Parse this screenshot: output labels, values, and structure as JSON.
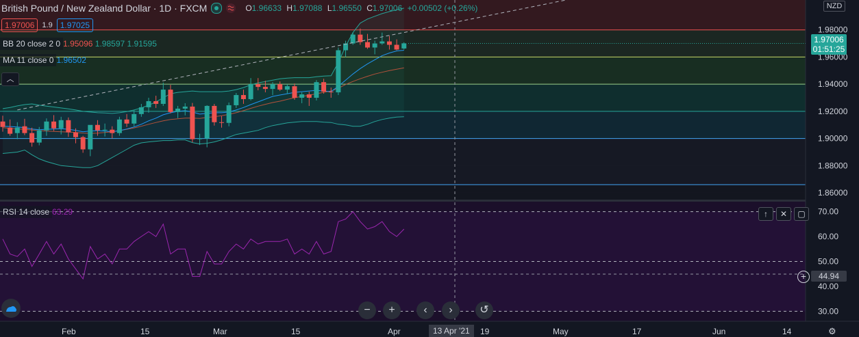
{
  "header": {
    "symbol_title": "British Pound / New Zealand Dollar · 1D · FXCM",
    "ohlc": {
      "o_label": "O",
      "o": "1.96633",
      "h_label": "H",
      "h": "1.97088",
      "l_label": "L",
      "l": "1.96550",
      "c_label": "C",
      "c": "1.97006",
      "change": "+0.00502 (+0.26%)"
    },
    "bid": "1.97006",
    "spread": "1.9",
    "ask": "1.97025"
  },
  "indicators": {
    "bb": {
      "label": "BB 20 close 2 0",
      "lower": "1.95096",
      "basis": "1.98597",
      "upper": "1.91595"
    },
    "ma": {
      "label": "MA 11 close 0",
      "value": "1.96502"
    },
    "rsi": {
      "label": "RSI 14 close",
      "value": "63.29"
    }
  },
  "price_axis": {
    "currency": "NZD",
    "ticks": [
      "1.98000",
      "1.96000",
      "1.94000",
      "1.92000",
      "1.90000",
      "1.88000",
      "1.86000"
    ],
    "last_price": "1.97006",
    "countdown": "01:51:25"
  },
  "rsi_axis": {
    "ticks": [
      "70.00",
      "60.00",
      "50.00",
      "40.00",
      "30.00"
    ],
    "cursor_value": "44.94"
  },
  "time_axis": {
    "labels": [
      "Feb",
      "15",
      "Mar",
      "15",
      "Apr",
      "19",
      "May",
      "17",
      "Jun",
      "14"
    ],
    "cursor_label": "13 Apr '21"
  },
  "colors": {
    "up": "#26a69a",
    "down": "#ef5350",
    "bb": "#26a69a",
    "ma": "#2196f3",
    "rsi": "#9c27b0",
    "background": "#131722"
  },
  "chart_data": {
    "type": "candlestick",
    "ylim": [
      1.855,
      2.002
    ],
    "candles": [
      [
        1.9125,
        1.9168,
        1.905,
        1.9085
      ],
      [
        1.908,
        1.914,
        1.902,
        1.9035
      ],
      [
        1.904,
        1.912,
        1.8995,
        1.908
      ],
      [
        1.909,
        1.9145,
        1.9025,
        1.904
      ],
      [
        1.904,
        1.908,
        1.894,
        1.897
      ],
      [
        1.897,
        1.9085,
        1.895,
        1.906
      ],
      [
        1.906,
        1.9148,
        1.902,
        1.9125
      ],
      [
        1.9125,
        1.9172,
        1.9055,
        1.9075
      ],
      [
        1.9075,
        1.916,
        1.903,
        1.9135
      ],
      [
        1.9135,
        1.9155,
        1.9012,
        1.9045
      ],
      [
        1.9045,
        1.9075,
        1.8965,
        1.901
      ],
      [
        1.901,
        1.902,
        1.8895,
        1.892
      ],
      [
        1.892,
        1.907,
        1.887,
        1.91
      ],
      [
        1.91,
        1.9135,
        1.902,
        1.906
      ],
      [
        1.906,
        1.911,
        1.9015,
        1.9065
      ],
      [
        1.9065,
        1.909,
        1.9,
        1.904
      ],
      [
        1.904,
        1.916,
        1.902,
        1.914
      ],
      [
        1.914,
        1.918,
        1.9085,
        1.911
      ],
      [
        1.911,
        1.921,
        1.909,
        1.918
      ],
      [
        1.918,
        1.9255,
        1.916,
        1.923
      ],
      [
        1.923,
        1.93,
        1.919,
        1.9275
      ],
      [
        1.9275,
        1.9315,
        1.9225,
        1.9255
      ],
      [
        1.9255,
        1.9412,
        1.924,
        1.936
      ],
      [
        1.936,
        1.9395,
        1.9185,
        1.9195
      ],
      [
        1.9195,
        1.924,
        1.915,
        1.922
      ],
      [
        1.922,
        1.926,
        1.917,
        1.9235
      ],
      [
        1.9235,
        1.9262,
        1.8972,
        1.8995
      ],
      [
        1.8995,
        1.9035,
        1.8952,
        1.9
      ],
      [
        1.9,
        1.9245,
        1.8935,
        1.924
      ],
      [
        1.924,
        1.9255,
        1.9095,
        1.912
      ],
      [
        1.912,
        1.9165,
        1.908,
        1.9115
      ],
      [
        1.9115,
        1.9265,
        1.909,
        1.9245
      ],
      [
        1.9245,
        1.9335,
        1.9225,
        1.932
      ],
      [
        1.932,
        1.936,
        1.9255,
        1.929
      ],
      [
        1.929,
        1.9445,
        1.928,
        1.94
      ],
      [
        1.94,
        1.9445,
        1.9355,
        1.938
      ],
      [
        1.938,
        1.9425,
        1.934,
        1.9365
      ],
      [
        1.9365,
        1.9415,
        1.932,
        1.94
      ],
      [
        1.94,
        1.942,
        1.935,
        1.936
      ],
      [
        1.936,
        1.94,
        1.933,
        1.9385
      ],
      [
        1.9385,
        1.9405,
        1.9285,
        1.93
      ],
      [
        1.93,
        1.934,
        1.926,
        1.9325
      ],
      [
        1.9325,
        1.9345,
        1.924,
        1.93
      ],
      [
        1.93,
        1.943,
        1.928,
        1.9415
      ],
      [
        1.9415,
        1.944,
        1.933,
        1.9345
      ],
      [
        1.9345,
        1.9375,
        1.93,
        1.934
      ],
      [
        1.934,
        1.967,
        1.932,
        1.965
      ],
      [
        1.965,
        1.972,
        1.96,
        1.97
      ],
      [
        1.97,
        1.978,
        1.969,
        1.9765
      ],
      [
        1.9765,
        1.981,
        1.969,
        1.971
      ],
      [
        1.971,
        1.977,
        1.966,
        1.967
      ],
      [
        1.967,
        1.972,
        1.962,
        1.97
      ],
      [
        1.97,
        1.978,
        1.969,
        1.9715
      ],
      [
        1.9715,
        1.9755,
        1.9655,
        1.969
      ],
      [
        1.969,
        1.973,
        1.965,
        1.9655
      ],
      [
        1.9663,
        1.9709,
        1.9655,
        1.9701
      ]
    ],
    "bb_upper": [
      1.922,
      1.9228,
      1.924,
      1.925,
      1.9255,
      1.9245,
      1.9238,
      1.9232,
      1.9225,
      1.9218,
      1.921,
      1.92,
      1.9195,
      1.919,
      1.9188,
      1.9185,
      1.919,
      1.9198,
      1.921,
      1.9225,
      1.9245,
      1.927,
      1.93,
      1.933,
      1.934,
      1.9345,
      1.935,
      1.9345,
      1.9345,
      1.9345,
      1.9345,
      1.935,
      1.936,
      1.9375,
      1.9395,
      1.941,
      1.942,
      1.943,
      1.944,
      1.9445,
      1.9448,
      1.9448,
      1.9448,
      1.9455,
      1.946,
      1.9462,
      1.956,
      1.968,
      1.978,
      1.985,
      1.988,
      1.99,
      1.992,
      1.9935,
      1.9948,
      1.996
    ],
    "bb_basis": [
      1.908,
      1.9075,
      1.907,
      1.9068,
      1.9062,
      1.9058,
      1.9055,
      1.9052,
      1.905,
      1.9048,
      1.9045,
      1.904,
      1.9038,
      1.904,
      1.9045,
      1.905,
      1.9058,
      1.9068,
      1.9078,
      1.909,
      1.9105,
      1.9118,
      1.913,
      1.914,
      1.9145,
      1.915,
      1.915,
      1.9148,
      1.9155,
      1.916,
      1.9168,
      1.9178,
      1.919,
      1.9205,
      1.9222,
      1.9238,
      1.9252,
      1.9265,
      1.9275,
      1.9288,
      1.93,
      1.931,
      1.9318,
      1.933,
      1.934,
      1.935,
      1.937,
      1.9398,
      1.942,
      1.944,
      1.9458,
      1.9475,
      1.9488,
      1.95,
      1.951,
      1.952
    ],
    "bb_lower": [
      1.889,
      1.8895,
      1.89,
      1.8915,
      1.888,
      1.885,
      1.883,
      1.8815,
      1.88,
      1.8795,
      1.879,
      1.8785,
      1.8785,
      1.88,
      1.883,
      1.886,
      1.889,
      1.892,
      1.895,
      1.8968,
      1.8975,
      1.898,
      1.8985,
      1.8985,
      1.899,
      1.899,
      1.897,
      1.896,
      1.8965,
      1.8975,
      1.899,
      1.901,
      1.903,
      1.904,
      1.905,
      1.906,
      1.908,
      1.9095,
      1.9105,
      1.9115,
      1.912,
      1.9125,
      1.9125,
      1.9125,
      1.912,
      1.9118,
      1.9105,
      1.91,
      1.909,
      1.909,
      1.9105,
      1.9125,
      1.914,
      1.915,
      1.9158,
      1.916
    ],
    "ma": [
      1.909,
      1.9088,
      1.9085,
      1.908,
      1.907,
      1.9065,
      1.9068,
      1.907,
      1.9072,
      1.9068,
      1.906,
      1.905,
      1.9055,
      1.9058,
      1.9055,
      1.905,
      1.9058,
      1.907,
      1.9085,
      1.9105,
      1.913,
      1.915,
      1.9175,
      1.919,
      1.92,
      1.9205,
      1.9195,
      1.918,
      1.9185,
      1.919,
      1.919,
      1.9195,
      1.921,
      1.9228,
      1.925,
      1.927,
      1.929,
      1.931,
      1.932,
      1.933,
      1.934,
      1.9345,
      1.935,
      1.9355,
      1.935,
      1.9345,
      1.9385,
      1.943,
      1.9475,
      1.9515,
      1.955,
      1.958,
      1.961,
      1.963,
      1.9645,
      1.965
    ],
    "rsi": [
      59,
      53,
      52,
      55,
      48,
      53,
      58,
      53,
      57,
      51,
      47,
      43,
      56,
      51,
      53,
      49,
      55,
      55,
      58,
      60,
      62,
      60,
      65,
      53,
      55,
      55,
      44,
      44,
      54,
      49,
      49,
      54,
      57,
      55,
      59,
      57,
      58,
      58,
      58,
      59,
      53,
      55,
      53,
      58,
      53,
      54,
      66,
      67,
      70,
      66,
      63,
      64,
      66,
      62,
      60,
      63
    ],
    "rsi_ylim": [
      26,
      74
    ],
    "horizontal_levels": [
      1.98,
      1.96,
      1.94,
      1.92,
      1.9,
      1.866
    ],
    "trendline": [
      [
        2,
        1.921
      ],
      [
        80,
        2.005
      ]
    ]
  }
}
